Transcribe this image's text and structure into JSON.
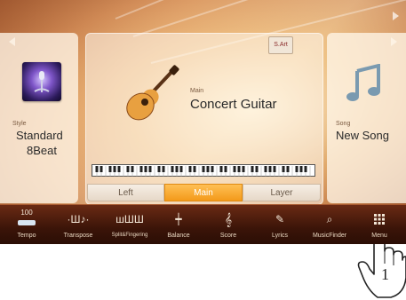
{
  "style_panel": {
    "category": "Style",
    "name_line1": "Standard",
    "name_line2": "8Beat"
  },
  "main_panel": {
    "category": "Main",
    "voice_name": "Concert Guitar",
    "sart_badge": "S.Art"
  },
  "song_panel": {
    "category": "Song",
    "name": "New Song"
  },
  "part_tabs": {
    "left": "Left",
    "main": "Main",
    "layer": "Layer",
    "selected": "Main"
  },
  "tempo": {
    "value": "100"
  },
  "toolbar": [
    {
      "label": "Tempo",
      "icon": "tempo-icon"
    },
    {
      "label": "Transpose",
      "icon": "transpose-icon"
    },
    {
      "label": "Split&Fingering",
      "icon": "split-fingering-icon"
    },
    {
      "label": "Balance",
      "icon": "balance-icon"
    },
    {
      "label": "Score",
      "icon": "score-icon"
    },
    {
      "label": "Lyrics",
      "icon": "lyrics-icon"
    },
    {
      "label": "MusicFinder",
      "icon": "musicfinder-icon"
    },
    {
      "label": "Menu",
      "icon": "menu-icon"
    }
  ],
  "callout": {
    "step": "1"
  },
  "colors": {
    "accent": "#f39a1a",
    "bar": "#3a1408"
  }
}
